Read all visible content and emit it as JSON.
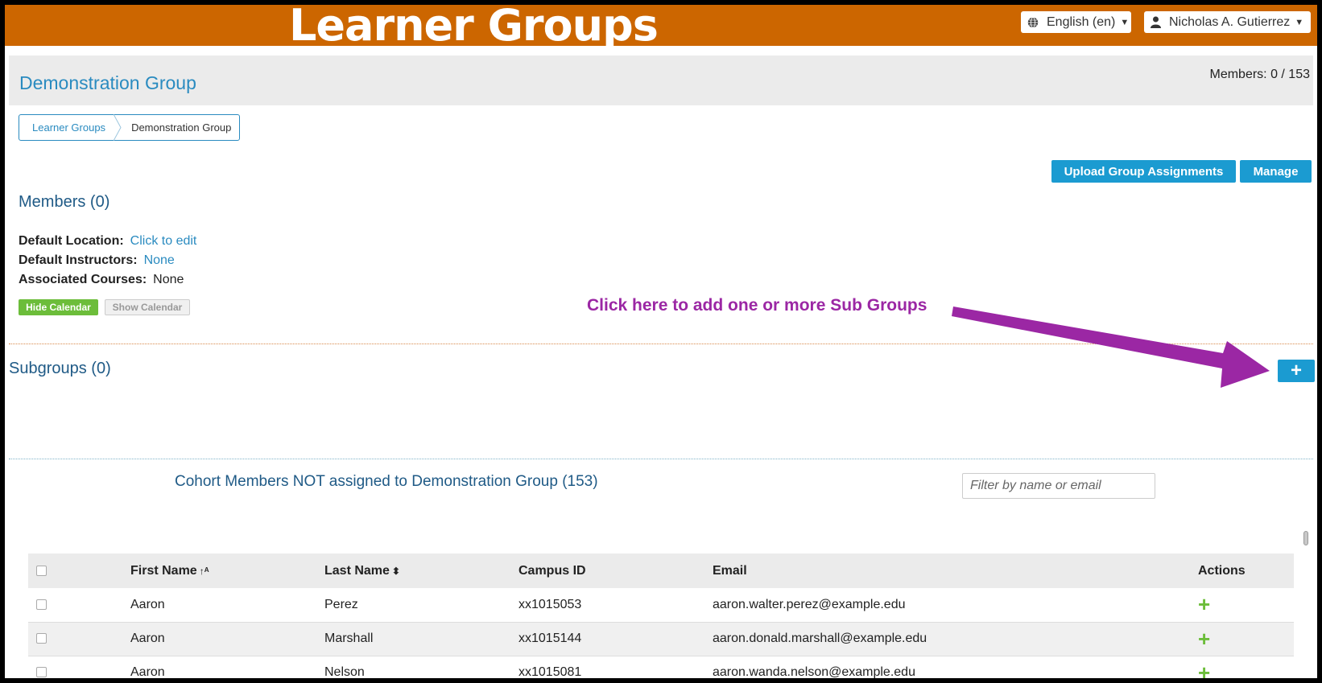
{
  "header": {
    "app_title": "Learner Groups",
    "language": "English (en)",
    "user": "Nicholas A. Gutierrez",
    "brand_color": "#cc6600"
  },
  "group": {
    "title": "Demonstration Group",
    "members_count": "Members: 0 / 153"
  },
  "breadcrumb": {
    "parent": "Learner Groups",
    "current": "Demonstration Group"
  },
  "actions": {
    "upload_label": "Upload Group Assignments",
    "manage_label": "Manage",
    "add_subgroup_label": "+"
  },
  "members": {
    "heading": "Members (0)",
    "default_location_label": "Default Location:",
    "default_location_value": "Click to edit",
    "default_instructors_label": "Default Instructors:",
    "default_instructors_value": "None",
    "associated_courses_label": "Associated Courses:",
    "associated_courses_value": "None",
    "hide_calendar": "Hide Calendar",
    "show_calendar": "Show Calendar"
  },
  "subgroups": {
    "heading": "Subgroups (0)",
    "annotation": "Click here to add one or more Sub Groups",
    "annotation_color": "#9b27a4"
  },
  "cohort": {
    "heading": "Cohort Members NOT assigned to Demonstration Group (153)",
    "filter_placeholder": "Filter by name or email",
    "columns": {
      "first_name": "First Name",
      "last_name": "Last Name",
      "campus_id": "Campus ID",
      "email": "Email",
      "actions": "Actions"
    },
    "rows": [
      {
        "first": "Aaron",
        "last": "Perez",
        "campus_id": "xx1015053",
        "email": "aaron.walter.perez@example.edu"
      },
      {
        "first": "Aaron",
        "last": "Marshall",
        "campus_id": "xx1015144",
        "email": "aaron.donald.marshall@example.edu"
      },
      {
        "first": "Aaron",
        "last": "Nelson",
        "campus_id": "xx1015081",
        "email": "aaron.wanda.nelson@example.edu"
      }
    ]
  }
}
